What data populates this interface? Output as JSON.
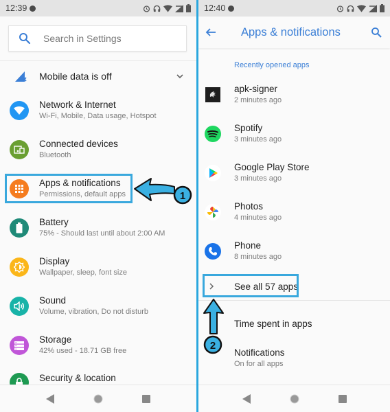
{
  "left_screen": {
    "status_bar": {
      "time": "12:39",
      "icons": [
        "notification-dot-icon",
        "alarm-icon",
        "headphones-icon",
        "wifi-icon",
        "signal-off-icon",
        "battery-icon"
      ]
    },
    "search": {
      "placeholder": "Search in Settings",
      "value": ""
    },
    "mobile_data_banner": {
      "label": "Mobile data is off",
      "icon": "signal-off-icon"
    },
    "items": [
      {
        "title": "Network & Internet",
        "subtitle": "Wi-Fi, Mobile, Data usage, Hotspot",
        "icon": "wifi-icon",
        "color": "#2196f3"
      },
      {
        "title": "Connected devices",
        "subtitle": "Bluetooth",
        "icon": "devices-icon",
        "color": "#6a9f31"
      },
      {
        "title": "Apps & notifications",
        "subtitle": "Permissions, default apps",
        "icon": "apps-grid-icon",
        "color": "#f57c1f",
        "highlighted": true
      },
      {
        "title": "Battery",
        "subtitle": "75% - Should last until about 2:00 AM",
        "icon": "battery-icon",
        "color": "#1f8a78"
      },
      {
        "title": "Display",
        "subtitle": "Wallpaper, sleep, font size",
        "icon": "brightness-icon",
        "color": "#fbb619"
      },
      {
        "title": "Sound",
        "subtitle": "Volume, vibration, Do not disturb",
        "icon": "volume-icon",
        "color": "#18b3a8"
      },
      {
        "title": "Storage",
        "subtitle": "42% used - 18.71 GB free",
        "icon": "storage-icon",
        "color": "#c056d8"
      },
      {
        "title": "Security & location",
        "subtitle": "",
        "icon": "lock-icon",
        "color": "#1e9a52"
      }
    ],
    "annotation": {
      "step": "1"
    },
    "nav": {
      "back": "back-icon",
      "home": "home-icon",
      "recents": "recents-icon"
    }
  },
  "right_screen": {
    "status_bar": {
      "time": "12:40",
      "icons": [
        "notification-dot-icon",
        "alarm-icon",
        "headphones-icon",
        "wifi-icon",
        "signal-off-icon",
        "battery-icon"
      ]
    },
    "app_bar": {
      "title": "Apps & notifications"
    },
    "section_header": "Recently opened apps",
    "recent_apps": [
      {
        "name": "apk-signer",
        "time": "2 minutes ago",
        "icon": "apk-signer-icon"
      },
      {
        "name": "Spotify",
        "time": "3 minutes ago",
        "icon": "spotify-icon"
      },
      {
        "name": "Google Play Store",
        "time": "3 minutes ago",
        "icon": "play-store-icon"
      },
      {
        "name": "Photos",
        "time": "4 minutes ago",
        "icon": "photos-icon"
      },
      {
        "name": "Phone",
        "time": "8 minutes ago",
        "icon": "phone-icon"
      }
    ],
    "see_all": {
      "label": "See all 57 apps"
    },
    "time_spent": {
      "title": "Time spent in apps"
    },
    "notifications": {
      "title": "Notifications",
      "subtitle": "On for all apps"
    },
    "annotation": {
      "step": "2"
    }
  },
  "colors": {
    "accent": "#3b7fd6",
    "highlight": "#39a8dd",
    "annotation_fill": "#3ab0e2"
  }
}
